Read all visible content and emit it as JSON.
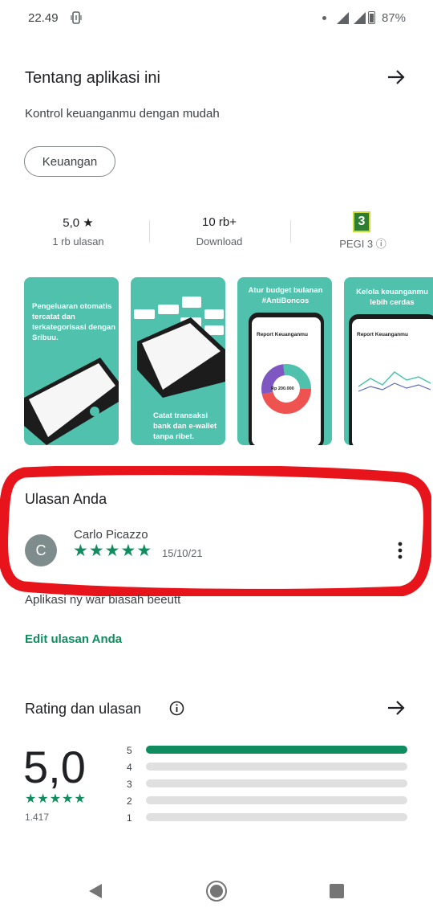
{
  "status_bar": {
    "time": "22.49",
    "battery": "87%"
  },
  "about": {
    "title": "Tentang aplikasi ini",
    "description": "Kontrol keuanganmu dengan mudah",
    "category": "Keuangan"
  },
  "stats": {
    "rating_value": "5,0 ★",
    "rating_label": "1 rb ulasan",
    "downloads_value": "10 rb+",
    "downloads_label": "Download",
    "pegi_value": "3",
    "pegi_label": "PEGI 3 ⓘ"
  },
  "screenshots": [
    {
      "text": "Pengeluaran otomatis tercatat dan terkategorisasi dengan Sribuu."
    },
    {
      "text": "Catat transaksi bank dan e-wallet tanpa ribet."
    },
    {
      "text": "Atur budget bulanan #AntiBoncos",
      "screen_title": "Report Keuanganmu",
      "amount": "Rp 200.000"
    },
    {
      "text": "Kelola keuanganmu lebih cerdas",
      "screen_title": "Report Keuanganmu"
    }
  ],
  "your_review": {
    "title": "Ulasan Anda",
    "avatar_letter": "C",
    "reviewer": "Carlo Picazzo",
    "stars": 5,
    "date": "15/10/21",
    "text": "Aplikasi ny war biasah beeutt",
    "edit_link": "Edit ulasan Anda"
  },
  "ratings": {
    "title": "Rating dan ulasan",
    "average": "5,0",
    "count": "1.417",
    "distribution": [
      {
        "label": "5",
        "fraction": 1.0
      },
      {
        "label": "4",
        "fraction": 0.0
      },
      {
        "label": "3",
        "fraction": 0.0
      },
      {
        "label": "2",
        "fraction": 0.0
      },
      {
        "label": "1",
        "fraction": 0.0
      }
    ]
  },
  "colors": {
    "accent_green": "#0f8d5e",
    "teal_screens": "#4fc1ad",
    "highlight_red": "#e8141b"
  },
  "nav": {
    "back": "back-icon",
    "home": "home-icon",
    "recents": "recents-icon"
  }
}
